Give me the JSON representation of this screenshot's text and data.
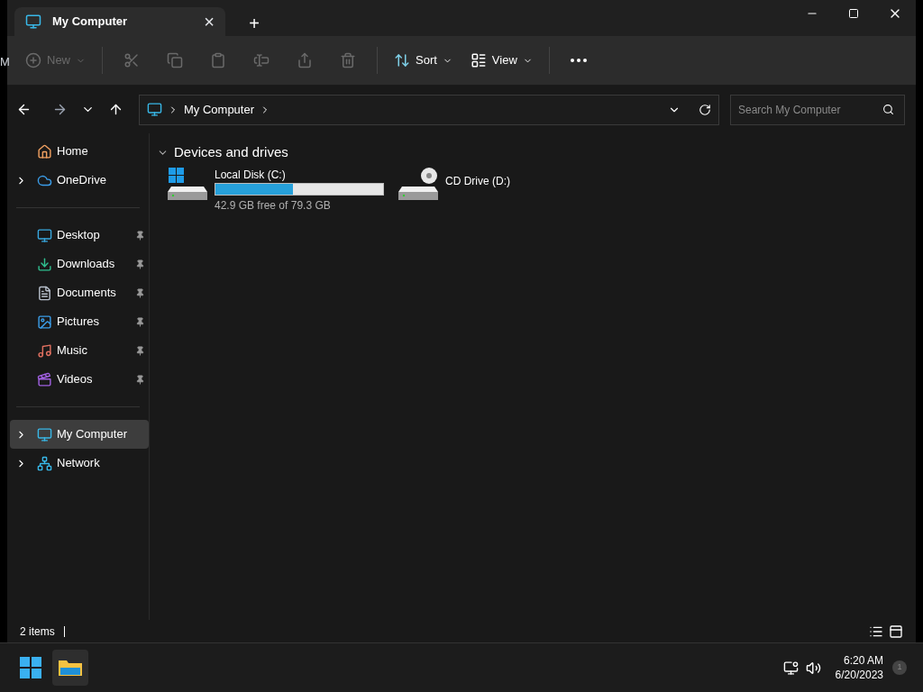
{
  "desktop_fragment": "M",
  "tab": {
    "title": "My Computer",
    "close": "×",
    "new_tab": "+"
  },
  "toolbar": [
    {
      "kind": "new",
      "label": "New",
      "disabled": true
    },
    {
      "kind": "cut",
      "disabled": true
    },
    {
      "kind": "copy",
      "disabled": true
    },
    {
      "kind": "paste",
      "disabled": true
    },
    {
      "kind": "rename",
      "disabled": true
    },
    {
      "kind": "share",
      "disabled": true
    },
    {
      "kind": "delete",
      "disabled": true
    },
    {
      "kind": "sort",
      "label": "Sort",
      "disabled": false
    },
    {
      "kind": "view",
      "label": "View",
      "disabled": false
    },
    {
      "kind": "more",
      "disabled": false
    }
  ],
  "address": {
    "crumbs": [
      "My Computer"
    ]
  },
  "search": {
    "placeholder": "Search My Computer"
  },
  "sidebar": {
    "groups": [
      [
        {
          "kind": "home",
          "label": "Home",
          "expandable": false,
          "pinned": false,
          "selected": false
        },
        {
          "kind": "onedrive",
          "label": "OneDrive",
          "expandable": true,
          "pinned": false,
          "selected": false
        }
      ],
      [
        {
          "kind": "desktop",
          "label": "Desktop",
          "expandable": false,
          "pinned": true,
          "selected": false
        },
        {
          "kind": "downloads",
          "label": "Downloads",
          "expandable": false,
          "pinned": true,
          "selected": false
        },
        {
          "kind": "documents",
          "label": "Documents",
          "expandable": false,
          "pinned": true,
          "selected": false
        },
        {
          "kind": "pictures",
          "label": "Pictures",
          "expandable": false,
          "pinned": true,
          "selected": false
        },
        {
          "kind": "music",
          "label": "Music",
          "expandable": false,
          "pinned": true,
          "selected": false
        },
        {
          "kind": "videos",
          "label": "Videos",
          "expandable": false,
          "pinned": true,
          "selected": false
        }
      ],
      [
        {
          "kind": "computer",
          "label": "My Computer",
          "expandable": true,
          "pinned": false,
          "selected": true
        },
        {
          "kind": "network",
          "label": "Network",
          "expandable": true,
          "pinned": false,
          "selected": false
        }
      ]
    ]
  },
  "section": {
    "title": "Devices and drives",
    "expanded": true
  },
  "drives": [
    {
      "kind": "disk",
      "name": "Local Disk (C:)",
      "level": 0.46,
      "detail": "42.9 GB free of 79.3 GB"
    },
    {
      "kind": "cd",
      "name": "CD Drive (D:)"
    }
  ],
  "status_bar": {
    "count": "2 items"
  },
  "taskbar": {
    "time": "6:20 AM",
    "date": "6/20/2023",
    "notifications": "1"
  }
}
